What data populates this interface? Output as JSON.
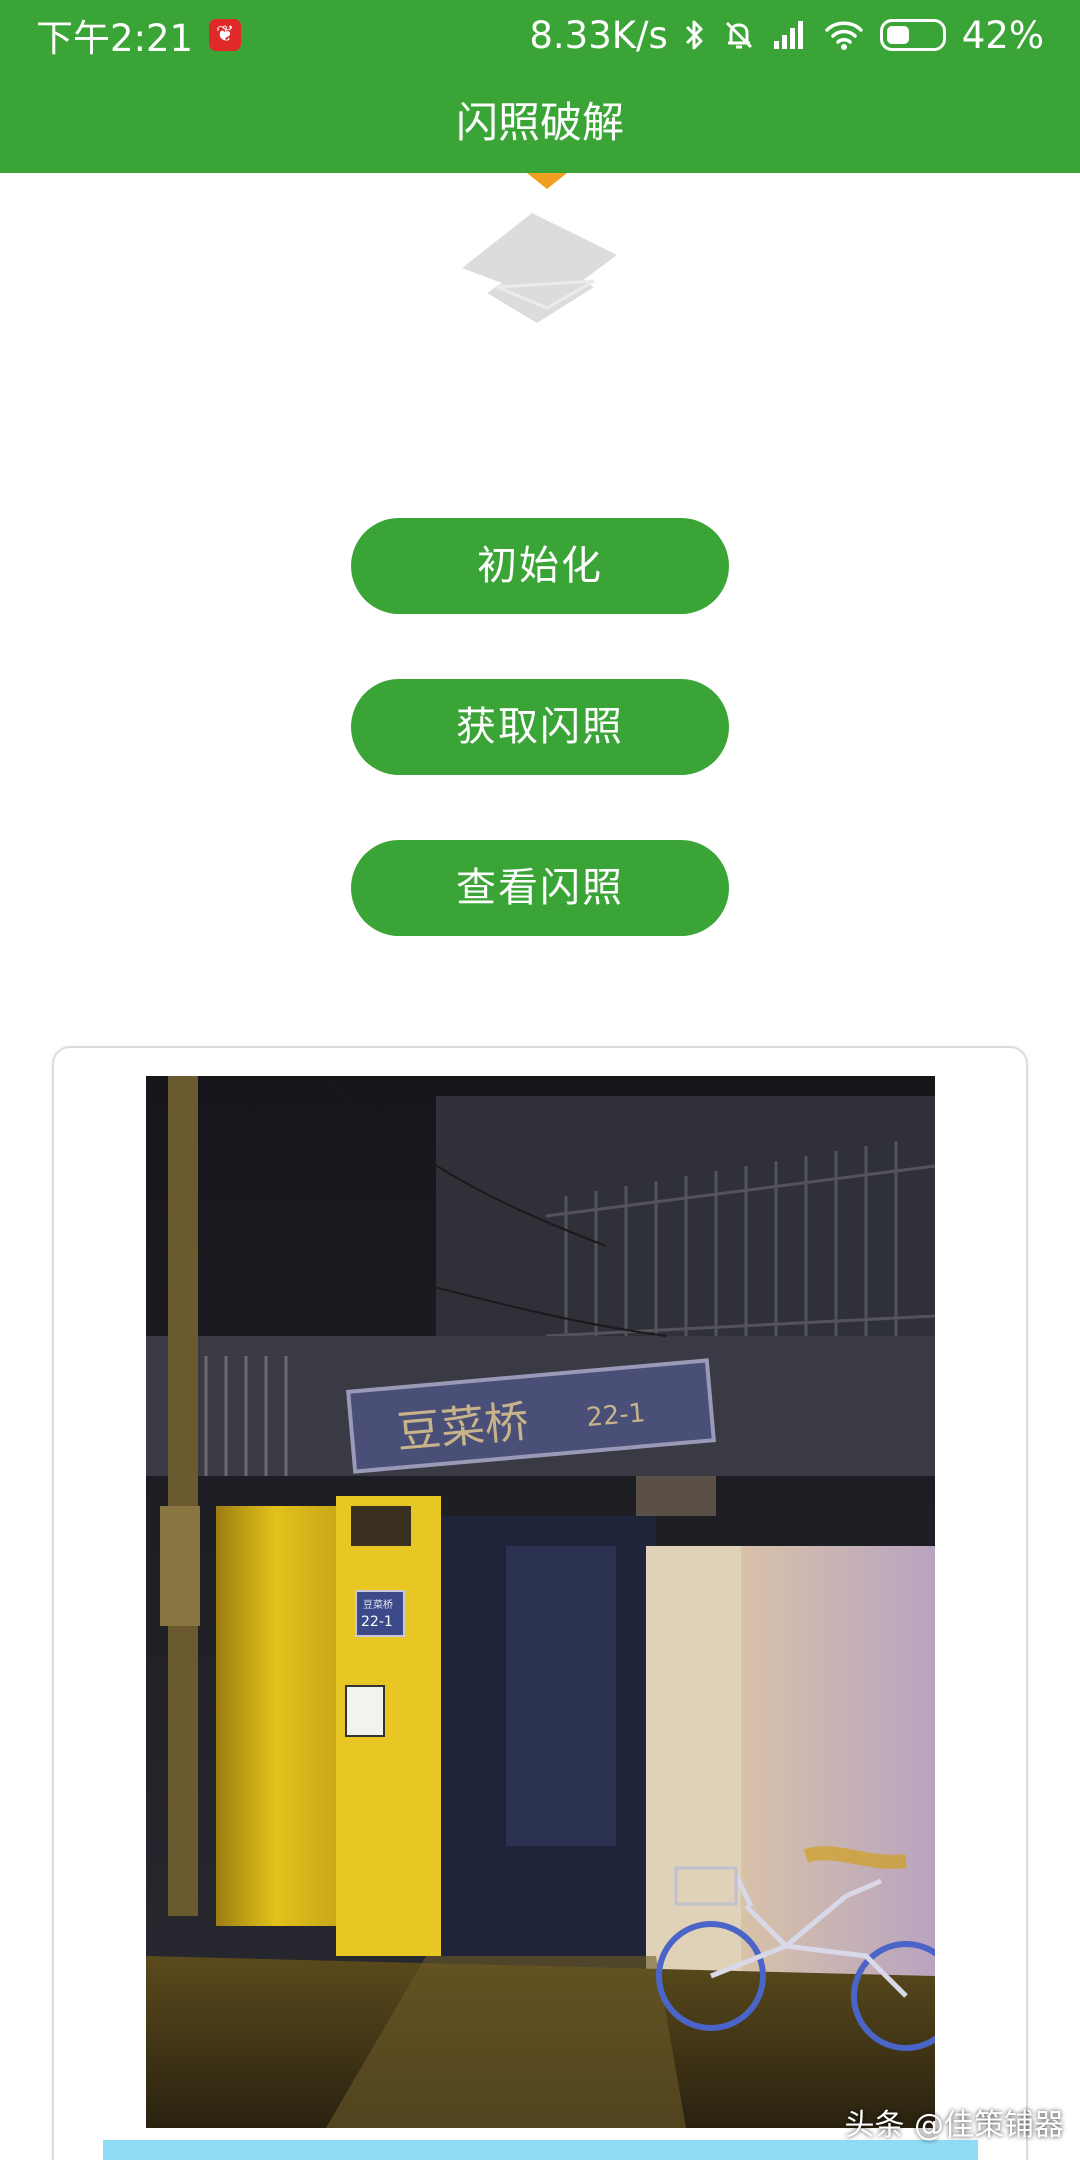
{
  "status_bar": {
    "time": "下午2:21",
    "network_speed": "8.33K/s",
    "battery": "42%",
    "battery_level": 0.42,
    "icons": [
      "app-notification-icon",
      "bluetooth-icon",
      "mute-bell-icon",
      "signal-icon",
      "wifi-icon",
      "battery-icon"
    ]
  },
  "app_bar": {
    "title": "闪照破解",
    "color": "#3aa536"
  },
  "buttons": {
    "init": "初始化",
    "fetch": "获取闪照",
    "view": "查看闪照"
  },
  "photo": {
    "sign_text": "豆菜桥",
    "sign_number": "22-1",
    "plate_text": "豆菜桥",
    "plate_number": "22-1"
  },
  "watermark": "头条 @佳策铺器"
}
